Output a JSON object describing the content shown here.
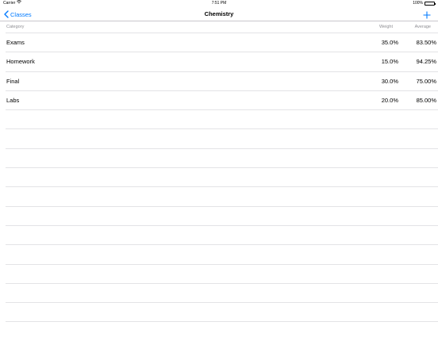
{
  "status_bar": {
    "carrier": "Carrier",
    "time": "7:51 PM",
    "battery": "100%",
    "battery_level": 1.0
  },
  "nav": {
    "back_label": "Classes",
    "title": "Chemistry"
  },
  "table": {
    "headers": {
      "category": "Category",
      "weight": "Weight",
      "average": "Average"
    },
    "rows": [
      {
        "category": "Exams",
        "weight": "35.0%",
        "average": "83.50%"
      },
      {
        "category": "Homework",
        "weight": "15.0%",
        "average": "94.25%"
      },
      {
        "category": "Final",
        "weight": "30.0%",
        "average": "75.00%"
      },
      {
        "category": "Labs",
        "weight": "20.0%",
        "average": "85.00%"
      }
    ]
  },
  "colors": {
    "accent": "#007aff",
    "separator": "#e3e3e6",
    "header_text": "#8e8e93"
  },
  "icons": {
    "back": "chevron-left-icon",
    "add": "plus-icon",
    "wifi": "wifi-icon",
    "battery": "battery-icon"
  }
}
